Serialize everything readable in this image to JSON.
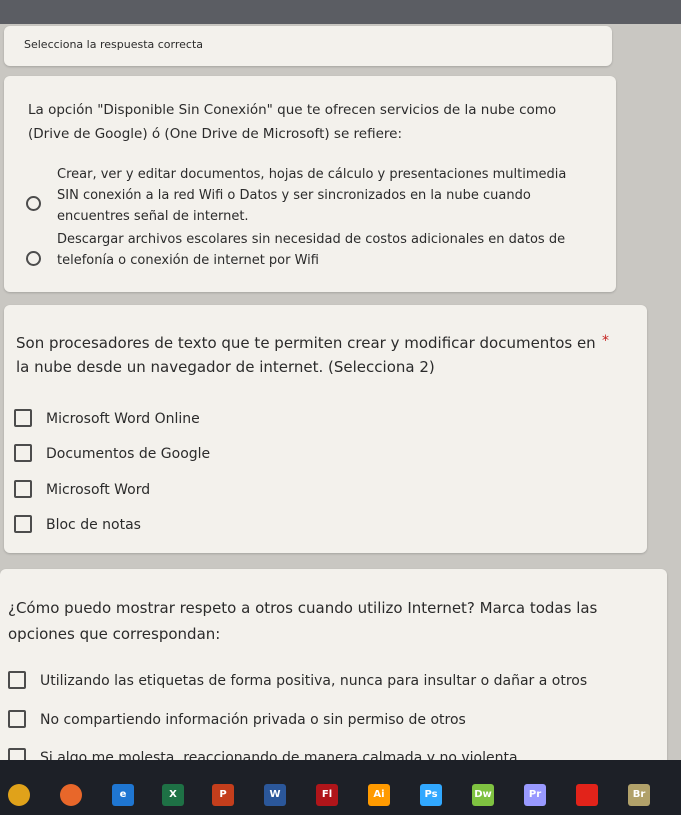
{
  "header_card": {
    "text": "Selecciona la respuesta correcta"
  },
  "q1": {
    "text": "La opción \"Disponible Sin Conexión\" que te ofrecen servicios de la nube como (Drive de Google) ó (One Drive de Microsoft) se refiere:",
    "options": [
      "Crear, ver y editar documentos, hojas de cálculo y presentaciones multimedia SIN conexión a la red Wifi o Datos y ser sincronizados en la nube cuando encuentres señal de internet.",
      "Descargar archivos escolares sin necesidad de costos adicionales en datos de telefonía o conexión de internet por Wifi"
    ]
  },
  "q2": {
    "text": "Son procesadores de texto que te permiten crear y modificar documentos en la nube desde un navegador de internet. (Selecciona 2)",
    "required_mark": "*",
    "options": [
      "Microsoft Word Online",
      "Documentos de Google",
      "Microsoft Word",
      "Bloc de notas"
    ]
  },
  "q3": {
    "text": "¿Cómo puedo mostrar respeto a otros cuando utilizo Internet? Marca todas las opciones que correspondan:",
    "options": [
      "Utilizando las etiquetas de forma positiva, nunca para insultar o dañar a otros",
      "No compartiendo información privada o sin permiso de otros",
      "Si algo me molesta, reaccionando de manera calmada y no violenta"
    ]
  },
  "taskbar": {
    "apps": [
      {
        "name": "chrome-icon",
        "label": "",
        "color": "#e0a21a"
      },
      {
        "name": "firefox-icon",
        "label": "",
        "color": "#e8672a"
      },
      {
        "name": "edge-icon",
        "label": "e",
        "color": "#1f76d2"
      },
      {
        "name": "excel-icon",
        "label": "X",
        "color": "#1e7145"
      },
      {
        "name": "powerpoint-icon",
        "label": "P",
        "color": "#c43e1c"
      },
      {
        "name": "word-icon",
        "label": "W",
        "color": "#2b579a"
      },
      {
        "name": "flash-icon",
        "label": "Fl",
        "color": "#b0151a"
      },
      {
        "name": "illustrator-icon",
        "label": "Ai",
        "color": "#ff9a00"
      },
      {
        "name": "photoshop-icon",
        "label": "Ps",
        "color": "#31a8ff"
      },
      {
        "name": "dreamweaver-icon",
        "label": "Dw",
        "color": "#7fc241"
      },
      {
        "name": "premiere-icon",
        "label": "Pr",
        "color": "#9999ff"
      },
      {
        "name": "acrobat-icon",
        "label": "",
        "color": "#e2231a"
      },
      {
        "name": "bridge-icon",
        "label": "Br",
        "color": "#b1a16a"
      }
    ]
  }
}
